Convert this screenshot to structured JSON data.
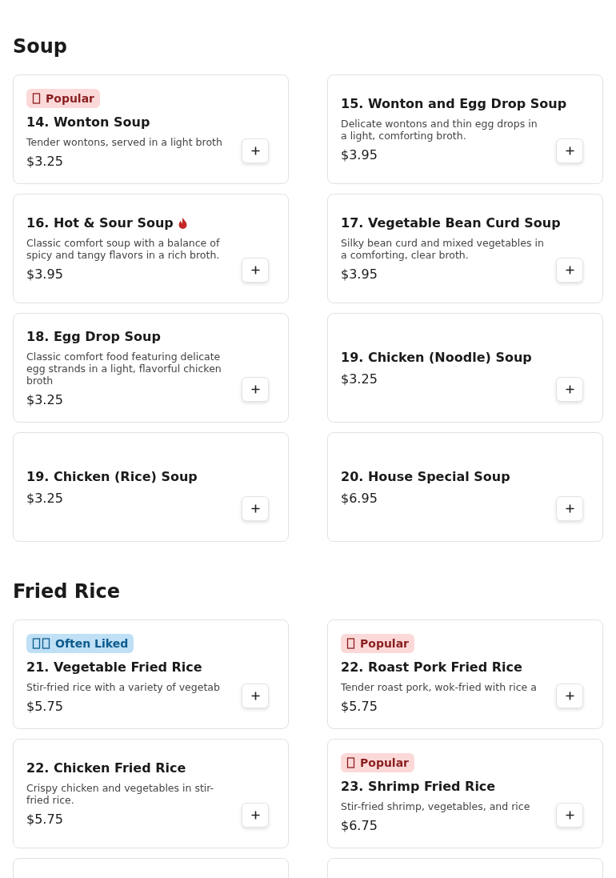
{
  "sections": [
    {
      "title": "Soup",
      "items": [
        {
          "kind": "dish",
          "badge": {
            "kind": "popular",
            "label": "Popular"
          },
          "name": "14. Wonton Soup",
          "spicy": false,
          "description": "Tender wontons, served in a light broth",
          "price": "$3.25"
        },
        {
          "kind": "dish",
          "name": "15. Wonton and Egg Drop Soup",
          "spicy": false,
          "description": "Delicate wontons and thin egg drops in a light, comforting broth.",
          "price": "$3.95"
        },
        {
          "kind": "dish",
          "name": "16. Hot & Sour Soup",
          "spicy": true,
          "description": "Classic comfort soup with a balance of spicy and tangy flavors in a rich broth.",
          "price": "$3.95"
        },
        {
          "kind": "dish",
          "name": "17. Vegetable Bean Curd Soup",
          "spicy": false,
          "description": "Silky bean curd and mixed vegetables in a comforting, clear broth.",
          "price": "$3.95"
        },
        {
          "kind": "dish",
          "name": "18. Egg Drop Soup",
          "spicy": false,
          "description": "Classic comfort food featuring delicate egg strands in a light, flavorful chicken broth",
          "price": "$3.25"
        },
        {
          "kind": "dish",
          "name": "19. Chicken (Noodle) Soup",
          "spicy": false,
          "price": "$3.25"
        },
        {
          "kind": "dish",
          "name": "19. Chicken (Rice) Soup",
          "spicy": false,
          "price": "$3.25"
        },
        {
          "kind": "dish",
          "name": "20. House Special Soup",
          "spicy": false,
          "price": "$6.95"
        }
      ]
    },
    {
      "title": "Fried Rice",
      "items": [
        {
          "kind": "dish",
          "badge": {
            "kind": "liked",
            "label": "Often Liked"
          },
          "name": "21. Vegetable Fried Rice",
          "spicy": false,
          "description": "Stir-fried rice with a variety of vegetab",
          "price": "$5.75"
        },
        {
          "kind": "dish",
          "badge": {
            "kind": "popular",
            "label": "Popular"
          },
          "name": "22. Roast Pork Fried Rice",
          "spicy": false,
          "description": "Tender roast pork, wok-fried with rice a",
          "price": "$5.75"
        },
        {
          "kind": "dish",
          "name": "22. Chicken Fried Rice",
          "spicy": false,
          "description": "Crispy chicken and vegetables in stir-fried rice.",
          "price": "$5.75"
        },
        {
          "kind": "dish",
          "badge": {
            "kind": "popular",
            "label": "Popular"
          },
          "name": "23. Shrimp Fried Rice",
          "spicy": false,
          "description": "Stir-fried shrimp, vegetables, and rice",
          "price": "$6.75"
        },
        {
          "kind": "cut"
        },
        {
          "kind": "cut"
        }
      ]
    }
  ]
}
